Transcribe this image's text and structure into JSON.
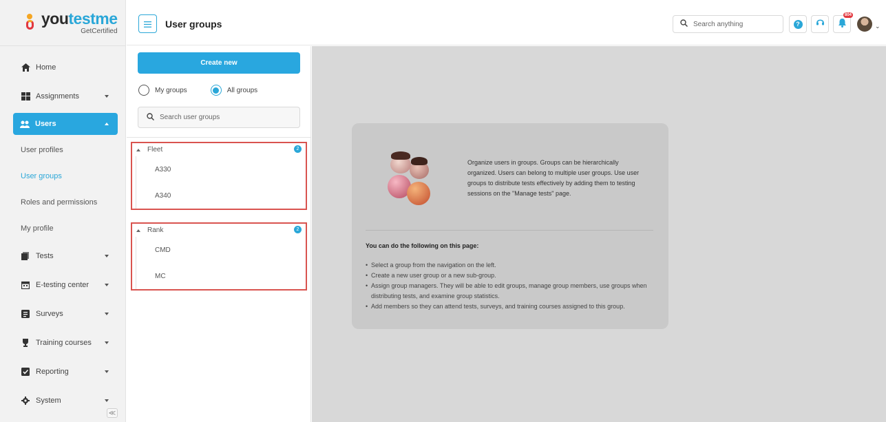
{
  "brand": {
    "name_part1": "you",
    "name_part2": "testme",
    "tagline": "GetCertified"
  },
  "sidebar": {
    "items": [
      {
        "label": "Home",
        "icon": "home-icon"
      },
      {
        "label": "Assignments",
        "icon": "assignments-icon"
      },
      {
        "label": "Users",
        "icon": "users-icon"
      },
      {
        "label": "User profiles"
      },
      {
        "label": "User groups"
      },
      {
        "label": "Roles and permissions"
      },
      {
        "label": "My profile"
      },
      {
        "label": "Tests",
        "icon": "tests-icon"
      },
      {
        "label": "E-testing center",
        "icon": "calendar-icon"
      },
      {
        "label": "Surveys",
        "icon": "surveys-icon"
      },
      {
        "label": "Training courses",
        "icon": "trophy-icon"
      },
      {
        "label": "Reporting",
        "icon": "reporting-icon"
      },
      {
        "label": "System",
        "icon": "gear-icon"
      }
    ],
    "collapse_label": "≪"
  },
  "header": {
    "title": "User groups",
    "search_placeholder": "Search anything",
    "help_label": "?",
    "notification_count": "804"
  },
  "groups_panel": {
    "create_label": "Create new",
    "radio_my": "My groups",
    "radio_all": "All groups",
    "search_placeholder": "Search user groups",
    "groups": [
      {
        "name": "Fleet",
        "count": "2",
        "children": [
          "A330",
          "A340"
        ]
      },
      {
        "name": "Rank",
        "count": "2",
        "children": [
          "CMD",
          "MC"
        ]
      }
    ]
  },
  "info": {
    "intro": "Organize users in groups. Groups can be hierarchically organized. Users can belong to multiple user groups. Use user groups to distribute tests effectively by adding them to testing sessions on the \"Manage tests\" page.",
    "heading": "You can do the following on this page:",
    "bullets": [
      "Select a group from the navigation on the left.",
      "Create a new user group or a new sub-group.",
      "Assign group managers. They will be able to edit groups, manage group members, use groups when distributing tests, and examine group statistics.",
      "Add members so they can attend tests, surveys, and training courses assigned to this group."
    ]
  },
  "colors": {
    "accent": "#29a7df",
    "highlight_border": "#d9534f",
    "badge": "#e2383f"
  }
}
